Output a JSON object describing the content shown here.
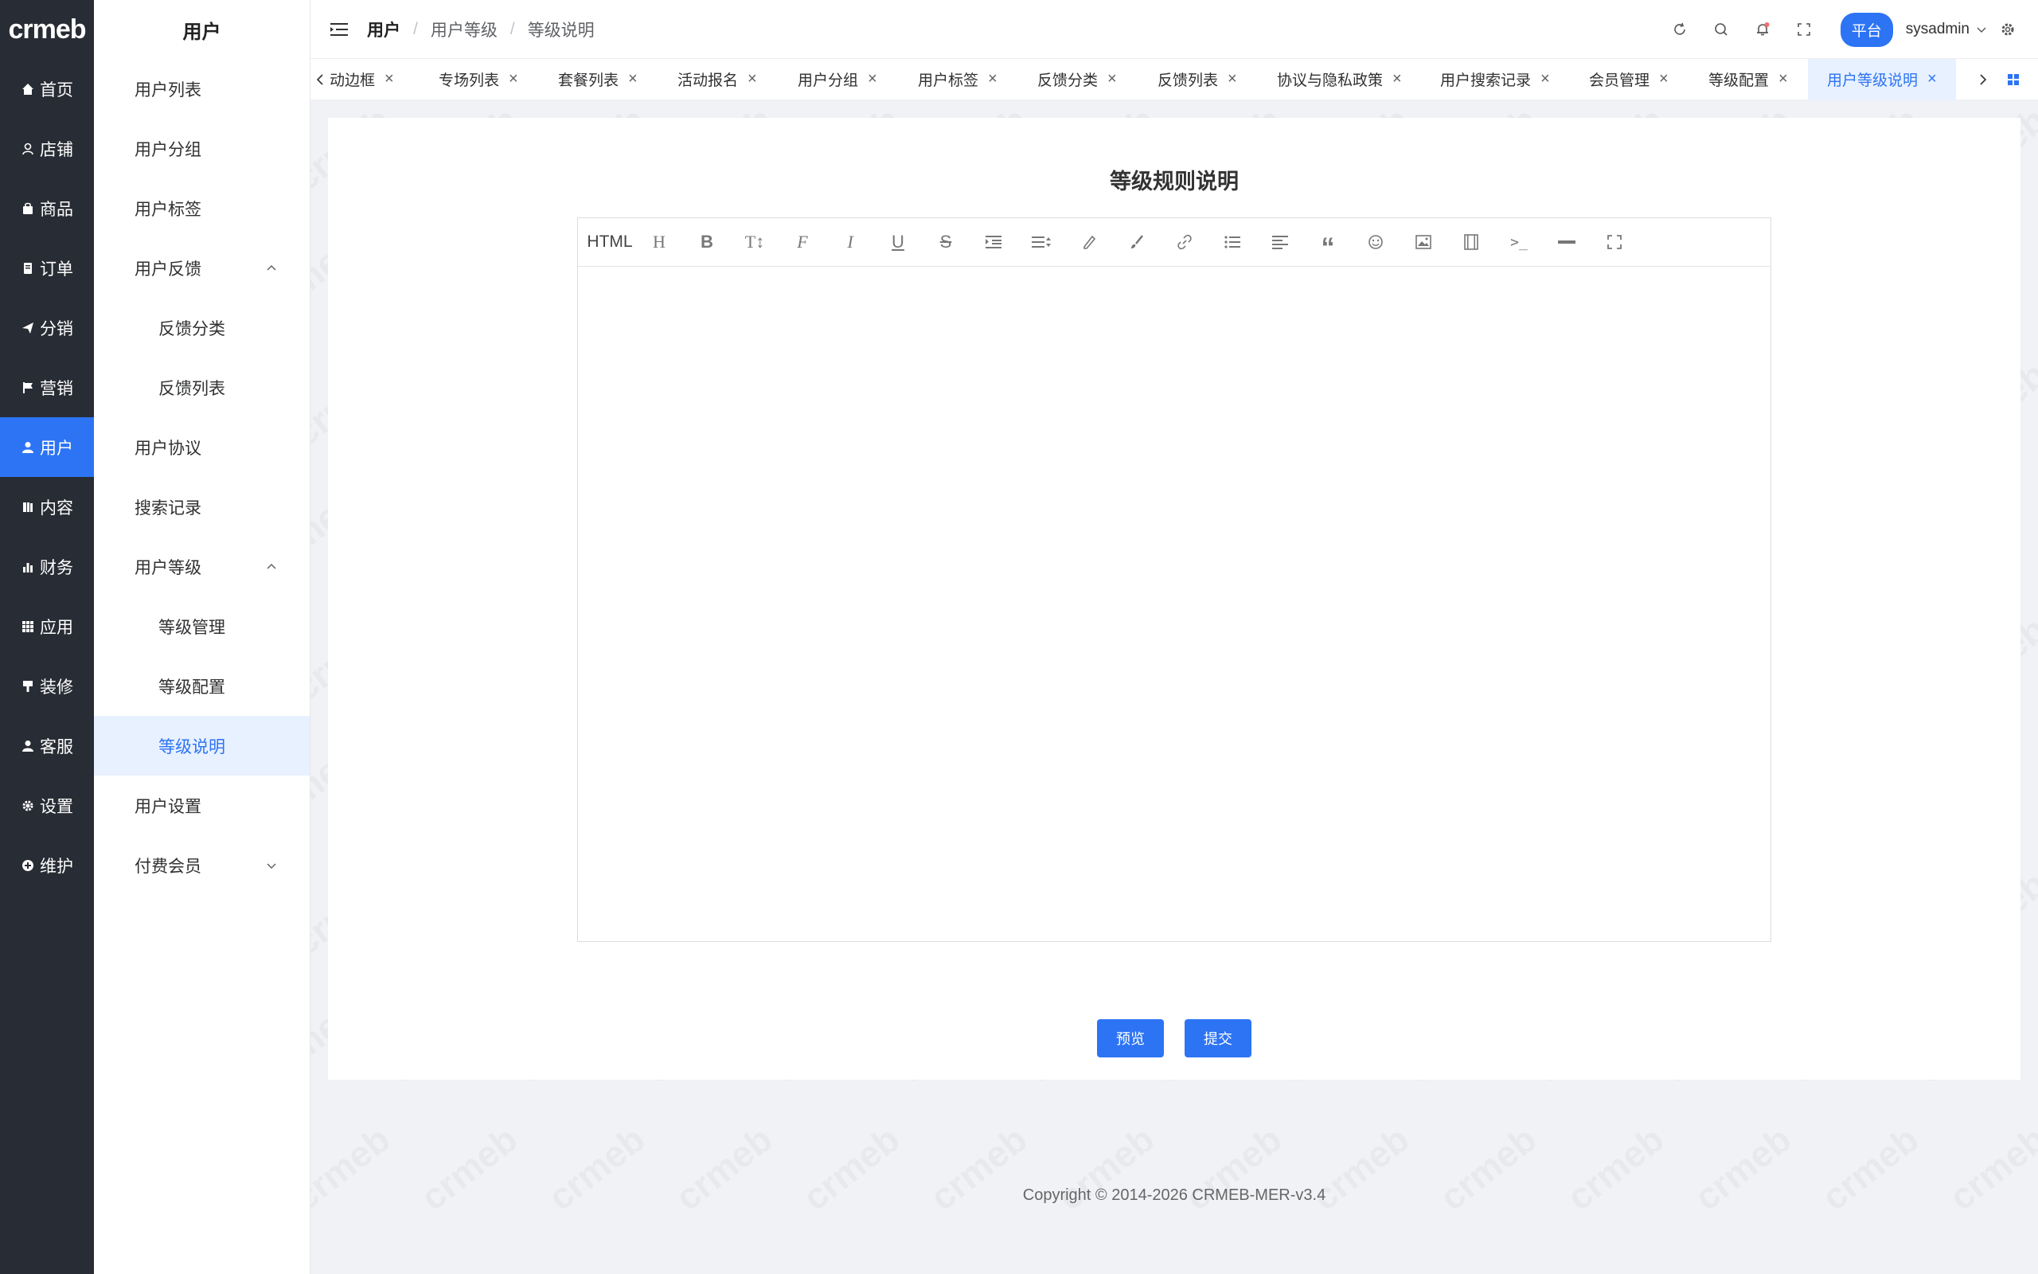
{
  "logo": {
    "text": "crmeb"
  },
  "rail": {
    "items": [
      {
        "label": "首页",
        "icon": "home-icon"
      },
      {
        "label": "店铺",
        "icon": "store-icon"
      },
      {
        "label": "商品",
        "icon": "bag-icon"
      },
      {
        "label": "订单",
        "icon": "order-icon"
      },
      {
        "label": "分销",
        "icon": "send-icon"
      },
      {
        "label": "营销",
        "icon": "flag-icon"
      },
      {
        "label": "用户",
        "icon": "user-icon"
      },
      {
        "label": "内容",
        "icon": "book-icon"
      },
      {
        "label": "财务",
        "icon": "chart-icon"
      },
      {
        "label": "应用",
        "icon": "grid-icon"
      },
      {
        "label": "装修",
        "icon": "brush-icon"
      },
      {
        "label": "客服",
        "icon": "service-icon"
      },
      {
        "label": "设置",
        "icon": "gear-icon"
      },
      {
        "label": "维护",
        "icon": "plus-circle-icon"
      }
    ],
    "active_index": 6
  },
  "submenu": {
    "title": "用户",
    "items": [
      {
        "label": "用户列表"
      },
      {
        "label": "用户分组"
      },
      {
        "label": "用户标签"
      },
      {
        "label": "用户反馈"
      },
      {
        "label": "反馈分类"
      },
      {
        "label": "反馈列表"
      },
      {
        "label": "用户协议"
      },
      {
        "label": "搜索记录"
      },
      {
        "label": "用户等级"
      },
      {
        "label": "等级管理"
      },
      {
        "label": "等级配置"
      },
      {
        "label": "等级说明"
      },
      {
        "label": "用户设置"
      },
      {
        "label": "付费会员"
      }
    ]
  },
  "breadcrumb": {
    "level1": "用户",
    "level2": "用户等级",
    "level3": "等级说明",
    "separator": "/"
  },
  "header": {
    "platform_badge": "平台",
    "username": "sysadmin"
  },
  "tabs": [
    {
      "label": "动边框"
    },
    {
      "label": "专场列表"
    },
    {
      "label": "套餐列表"
    },
    {
      "label": "活动报名"
    },
    {
      "label": "用户分组"
    },
    {
      "label": "用户标签"
    },
    {
      "label": "反馈分类"
    },
    {
      "label": "反馈列表"
    },
    {
      "label": "协议与隐私政策"
    },
    {
      "label": "用户搜索记录"
    },
    {
      "label": "会员管理"
    },
    {
      "label": "等级配置"
    },
    {
      "label": "用户等级说明"
    }
  ],
  "page": {
    "title": "等级规则说明"
  },
  "editor": {
    "html_label": "HTML",
    "content": ""
  },
  "buttons": {
    "preview": "预览",
    "submit": "提交"
  },
  "footer": {
    "copyright": "Copyright © 2014-2026 CRMEB-MER-v3.4"
  },
  "colors": {
    "accent": "#2d74f5",
    "rail_bg": "#282c34",
    "active_bg": "#e8f1ff"
  }
}
